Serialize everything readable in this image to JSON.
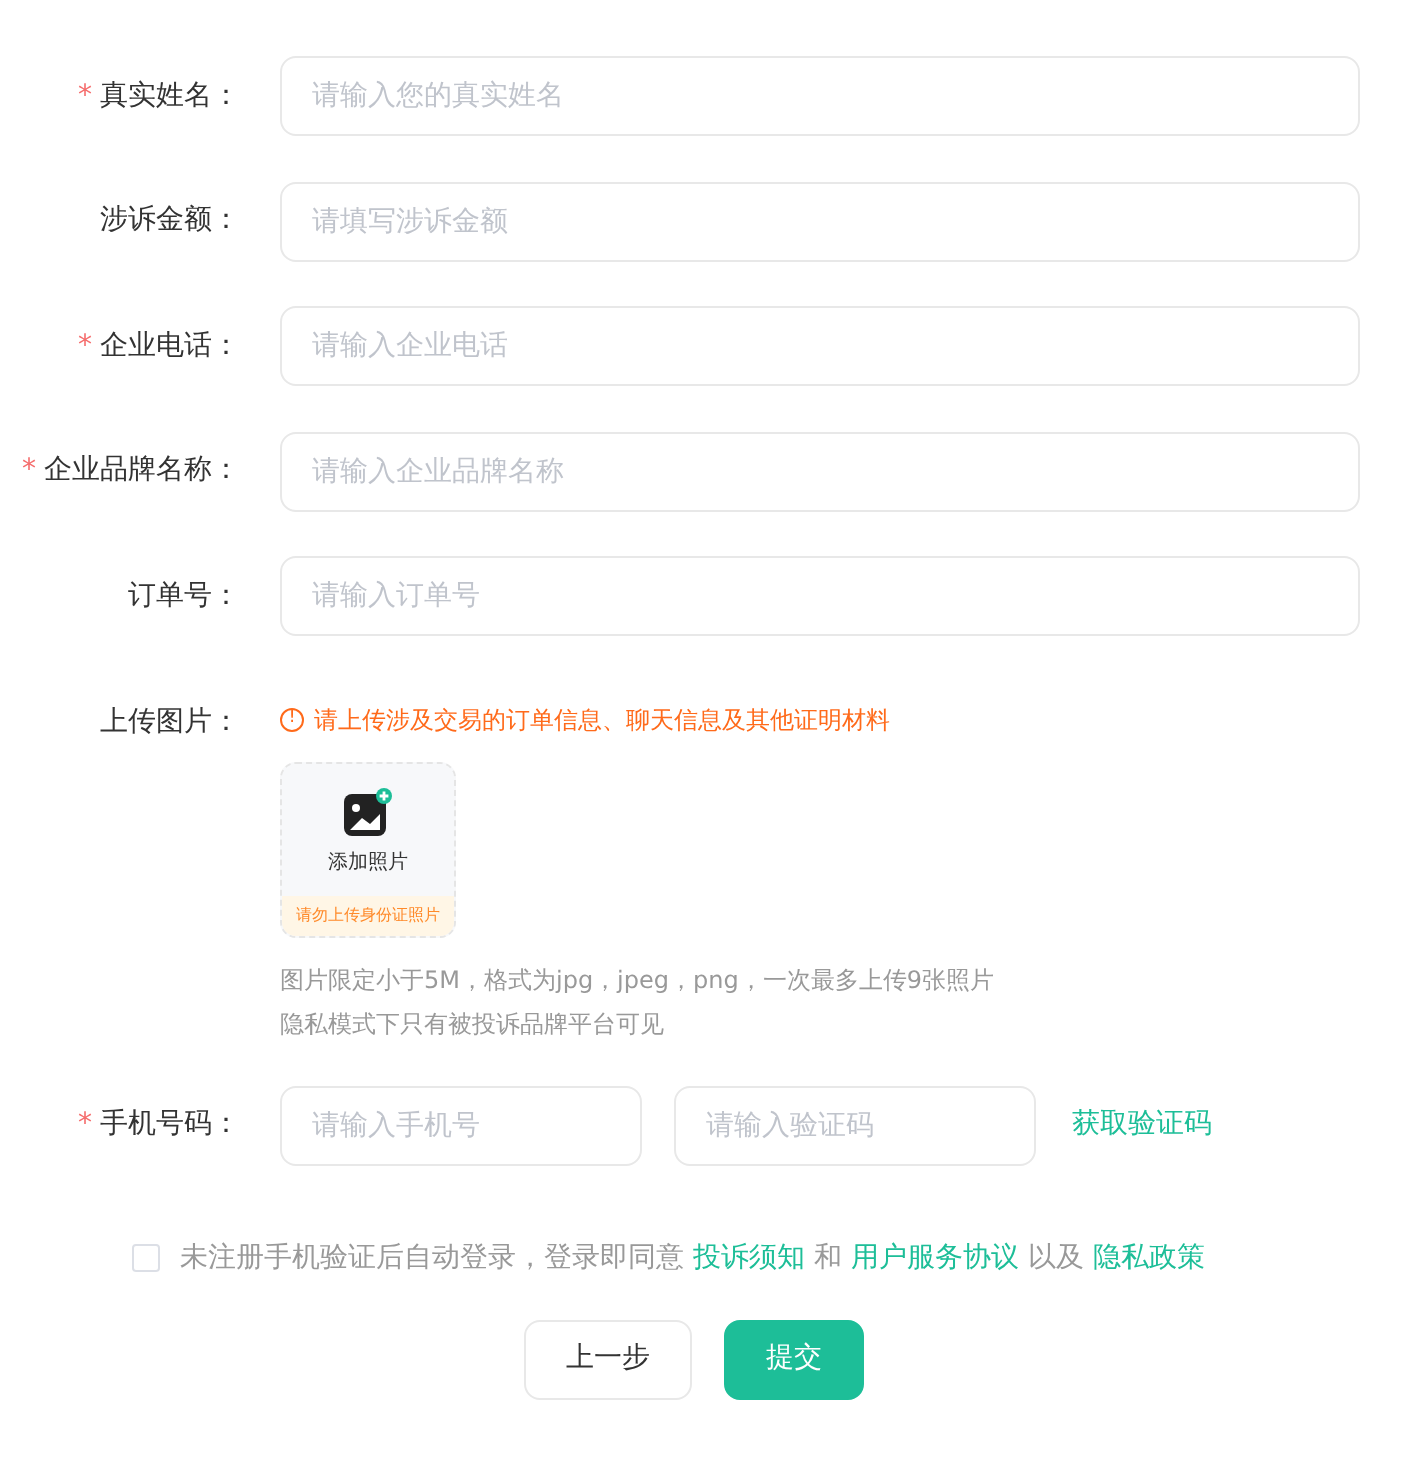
{
  "required_marker": "*",
  "fields": [
    {
      "label": "真实姓名：",
      "required": true,
      "placeholder": "请输入您的真实姓名"
    },
    {
      "label": "涉诉金额：",
      "required": false,
      "placeholder": "请填写涉诉金额"
    },
    {
      "label": "企业电话：",
      "required": true,
      "placeholder": "请输入企业电话"
    },
    {
      "label": "企业品牌名称：",
      "required": true,
      "placeholder": "请输入企业品牌名称"
    },
    {
      "label": "订单号：",
      "required": false,
      "placeholder": "请输入订单号"
    }
  ],
  "upload": {
    "label": "上传图片：",
    "warning_icon": "!",
    "warning": "请上传涉及交易的订单信息、聊天信息及其他证明材料",
    "button_label": "添加照片",
    "button_note": "请勿上传身份证照片",
    "hints": [
      "图片限定小于5M，格式为jpg，jpeg，png，一次最多上传9张照片",
      "隐私模式下只有被投诉品牌平台可见"
    ]
  },
  "phone": {
    "label": "手机号码：",
    "required": true,
    "placeholder": "请输入手机号",
    "code_placeholder": "请输入验证码",
    "get_code": "获取验证码"
  },
  "consent": {
    "checked": false,
    "parts": [
      {
        "text": "未注册手机验证后自动登录，登录即同意 ",
        "link": false
      },
      {
        "text": "投诉须知",
        "link": true
      },
      {
        "text": " 和 ",
        "link": false
      },
      {
        "text": "用户服务协议",
        "link": true
      },
      {
        "text": " 以及 ",
        "link": false
      },
      {
        "text": "隐私政策",
        "link": true
      }
    ]
  },
  "buttons": [
    {
      "label": "上一步",
      "kind": "secondary"
    },
    {
      "label": "提交",
      "kind": "primary"
    }
  ]
}
